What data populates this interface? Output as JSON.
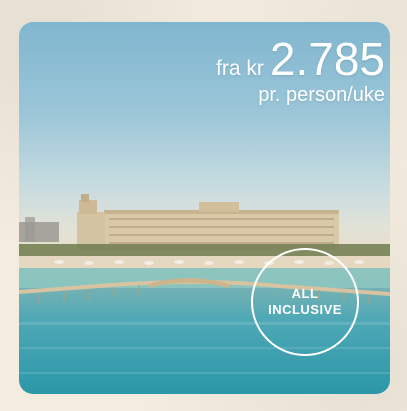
{
  "offer": {
    "price_prefix": "fra kr",
    "price_amount": "2.785",
    "price_unit": "pr. person/uke",
    "badge_line1": "ALL",
    "badge_line2": "INCLUSIVE"
  },
  "colors": {
    "sky": "#8fbfd4",
    "sea": "#2b97a8",
    "text": "#ffffff",
    "frame": "#f3ecdf"
  }
}
